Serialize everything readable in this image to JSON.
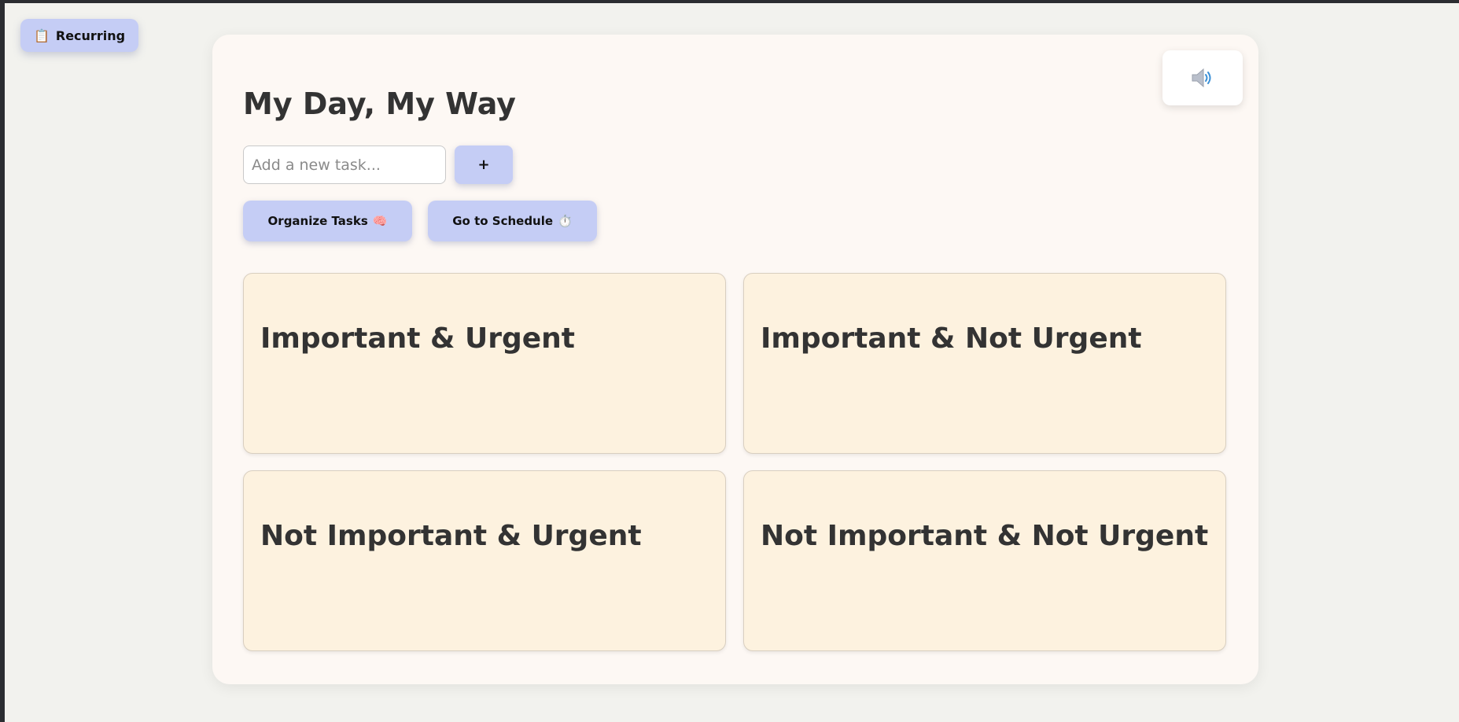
{
  "recurring": {
    "icon": "clipboard-icon",
    "emoji": "📋",
    "label": "Recurring"
  },
  "sound": {
    "icon": "speaker-icon"
  },
  "header": {
    "title": "My Day, My Way"
  },
  "task_input": {
    "value": "",
    "placeholder": "Add a new task..."
  },
  "add_button": {
    "label": "+"
  },
  "actions": {
    "organize": {
      "label": "Organize Tasks",
      "emoji": "🧠",
      "icon": "brain-icon"
    },
    "schedule": {
      "label": "Go to Schedule",
      "emoji": "⏱️",
      "icon": "stopwatch-icon"
    }
  },
  "quadrants": [
    {
      "title": "Important & Urgent"
    },
    {
      "title": "Important & Not Urgent"
    },
    {
      "title": "Not Important & Urgent"
    },
    {
      "title": "Not Important & Not Urgent"
    }
  ],
  "colors": {
    "accent_button": "#c5cdf5",
    "card_background": "#fdf8f4",
    "quadrant_background": "#fdf2df",
    "text": "#333333"
  }
}
